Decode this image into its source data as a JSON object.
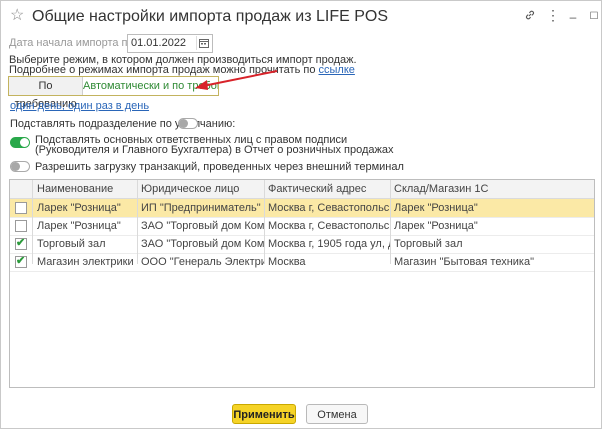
{
  "window": {
    "title": "Общие настройки импорта продаж из LIFE POS",
    "icons": {
      "favorite": "star-icon",
      "link": "link-icon",
      "more": "more-icon",
      "minimize": "minimize-icon",
      "maximize": "maximize-icon",
      "close": "close-icon"
    }
  },
  "form": {
    "start_date_label": "Дата начала импорта продаж:",
    "start_date_value": "01.01.2022",
    "mode_description_line1": "Выберите режим, в котором должен производиться импорт продаж.",
    "mode_description_line2": "Подробнее о режимах импорта продаж можно прочитать по",
    "mode_description_link": "ссылке",
    "mode_options": [
      "По требованию",
      "Автоматически и по требованию"
    ],
    "mode_selected": "Автоматически и по требованию",
    "schedule_link": "один день; один раз в день",
    "substitute_department": {
      "label": "Подставлять подразделение по умолчанию:",
      "on": false
    },
    "substitute_responsible": {
      "label_line1": "Подставлять основных ответственных лиц с правом подписи",
      "label_line2": "(Руководителя и Главного Бухгалтера) в Отчет о розничных продажах",
      "on": true
    },
    "external_terminal": {
      "label": "Разрешить загрузку транзакций, проведенных через внешний терминал",
      "on": false
    }
  },
  "table": {
    "columns": [
      "Наименование",
      "Юридическое лицо",
      "Фактический адрес",
      "Склад/Магазин 1С"
    ],
    "rows": [
      {
        "checked": false,
        "selected": true,
        "name": "Ларек \"Розница\"",
        "legal": "ИП \"Предприниматель\"",
        "address": "Москва г, Севастопольска...",
        "store": "Ларек \"Розница\""
      },
      {
        "checked": false,
        "selected": false,
        "name": "Ларек \"Розница\"",
        "legal": "ЗАО \"Торговый дом Компл...",
        "address": "Москва г, Севастопольска...",
        "store": "Ларек \"Розница\""
      },
      {
        "checked": true,
        "selected": false,
        "name": "Торговый зал",
        "legal": "ЗАО \"Торговый дом Компл...",
        "address": "Москва г, 1905 года ул, до...",
        "store": "Торговый зал"
      },
      {
        "checked": true,
        "selected": false,
        "name": "Магазин электрики",
        "legal": "ООО \"Генераль Электрик\"",
        "address": "Москва",
        "store": "Магазин \"Бытовая техника\""
      }
    ]
  },
  "buttons": {
    "apply": "Применить",
    "cancel": "Отмена"
  },
  "colors": {
    "accent_yellow": "#f5d327",
    "selected_row": "#fbe9a6",
    "toggle_on": "#29a84a",
    "link": "#2a66b8",
    "annotation_arrow": "#d8232a"
  }
}
